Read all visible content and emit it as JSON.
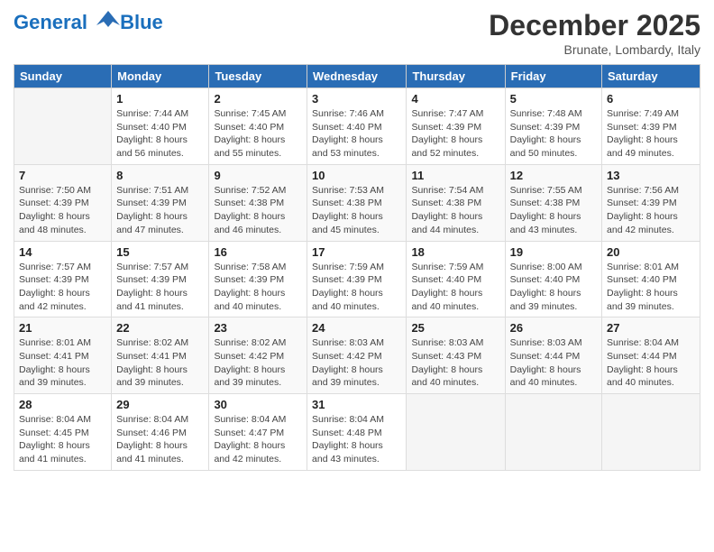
{
  "header": {
    "logo_line1": "General",
    "logo_line2": "Blue",
    "month": "December 2025",
    "location": "Brunate, Lombardy, Italy"
  },
  "weekdays": [
    "Sunday",
    "Monday",
    "Tuesday",
    "Wednesday",
    "Thursday",
    "Friday",
    "Saturday"
  ],
  "weeks": [
    [
      {
        "day": "",
        "info": ""
      },
      {
        "day": "1",
        "info": "Sunrise: 7:44 AM\nSunset: 4:40 PM\nDaylight: 8 hours\nand 56 minutes."
      },
      {
        "day": "2",
        "info": "Sunrise: 7:45 AM\nSunset: 4:40 PM\nDaylight: 8 hours\nand 55 minutes."
      },
      {
        "day": "3",
        "info": "Sunrise: 7:46 AM\nSunset: 4:40 PM\nDaylight: 8 hours\nand 53 minutes."
      },
      {
        "day": "4",
        "info": "Sunrise: 7:47 AM\nSunset: 4:39 PM\nDaylight: 8 hours\nand 52 minutes."
      },
      {
        "day": "5",
        "info": "Sunrise: 7:48 AM\nSunset: 4:39 PM\nDaylight: 8 hours\nand 50 minutes."
      },
      {
        "day": "6",
        "info": "Sunrise: 7:49 AM\nSunset: 4:39 PM\nDaylight: 8 hours\nand 49 minutes."
      }
    ],
    [
      {
        "day": "7",
        "info": "Sunrise: 7:50 AM\nSunset: 4:39 PM\nDaylight: 8 hours\nand 48 minutes."
      },
      {
        "day": "8",
        "info": "Sunrise: 7:51 AM\nSunset: 4:39 PM\nDaylight: 8 hours\nand 47 minutes."
      },
      {
        "day": "9",
        "info": "Sunrise: 7:52 AM\nSunset: 4:38 PM\nDaylight: 8 hours\nand 46 minutes."
      },
      {
        "day": "10",
        "info": "Sunrise: 7:53 AM\nSunset: 4:38 PM\nDaylight: 8 hours\nand 45 minutes."
      },
      {
        "day": "11",
        "info": "Sunrise: 7:54 AM\nSunset: 4:38 PM\nDaylight: 8 hours\nand 44 minutes."
      },
      {
        "day": "12",
        "info": "Sunrise: 7:55 AM\nSunset: 4:38 PM\nDaylight: 8 hours\nand 43 minutes."
      },
      {
        "day": "13",
        "info": "Sunrise: 7:56 AM\nSunset: 4:39 PM\nDaylight: 8 hours\nand 42 minutes."
      }
    ],
    [
      {
        "day": "14",
        "info": "Sunrise: 7:57 AM\nSunset: 4:39 PM\nDaylight: 8 hours\nand 42 minutes."
      },
      {
        "day": "15",
        "info": "Sunrise: 7:57 AM\nSunset: 4:39 PM\nDaylight: 8 hours\nand 41 minutes."
      },
      {
        "day": "16",
        "info": "Sunrise: 7:58 AM\nSunset: 4:39 PM\nDaylight: 8 hours\nand 40 minutes."
      },
      {
        "day": "17",
        "info": "Sunrise: 7:59 AM\nSunset: 4:39 PM\nDaylight: 8 hours\nand 40 minutes."
      },
      {
        "day": "18",
        "info": "Sunrise: 7:59 AM\nSunset: 4:40 PM\nDaylight: 8 hours\nand 40 minutes."
      },
      {
        "day": "19",
        "info": "Sunrise: 8:00 AM\nSunset: 4:40 PM\nDaylight: 8 hours\nand 39 minutes."
      },
      {
        "day": "20",
        "info": "Sunrise: 8:01 AM\nSunset: 4:40 PM\nDaylight: 8 hours\nand 39 minutes."
      }
    ],
    [
      {
        "day": "21",
        "info": "Sunrise: 8:01 AM\nSunset: 4:41 PM\nDaylight: 8 hours\nand 39 minutes."
      },
      {
        "day": "22",
        "info": "Sunrise: 8:02 AM\nSunset: 4:41 PM\nDaylight: 8 hours\nand 39 minutes."
      },
      {
        "day": "23",
        "info": "Sunrise: 8:02 AM\nSunset: 4:42 PM\nDaylight: 8 hours\nand 39 minutes."
      },
      {
        "day": "24",
        "info": "Sunrise: 8:03 AM\nSunset: 4:42 PM\nDaylight: 8 hours\nand 39 minutes."
      },
      {
        "day": "25",
        "info": "Sunrise: 8:03 AM\nSunset: 4:43 PM\nDaylight: 8 hours\nand 40 minutes."
      },
      {
        "day": "26",
        "info": "Sunrise: 8:03 AM\nSunset: 4:44 PM\nDaylight: 8 hours\nand 40 minutes."
      },
      {
        "day": "27",
        "info": "Sunrise: 8:04 AM\nSunset: 4:44 PM\nDaylight: 8 hours\nand 40 minutes."
      }
    ],
    [
      {
        "day": "28",
        "info": "Sunrise: 8:04 AM\nSunset: 4:45 PM\nDaylight: 8 hours\nand 41 minutes."
      },
      {
        "day": "29",
        "info": "Sunrise: 8:04 AM\nSunset: 4:46 PM\nDaylight: 8 hours\nand 41 minutes."
      },
      {
        "day": "30",
        "info": "Sunrise: 8:04 AM\nSunset: 4:47 PM\nDaylight: 8 hours\nand 42 minutes."
      },
      {
        "day": "31",
        "info": "Sunrise: 8:04 AM\nSunset: 4:48 PM\nDaylight: 8 hours\nand 43 minutes."
      },
      {
        "day": "",
        "info": ""
      },
      {
        "day": "",
        "info": ""
      },
      {
        "day": "",
        "info": ""
      }
    ]
  ]
}
